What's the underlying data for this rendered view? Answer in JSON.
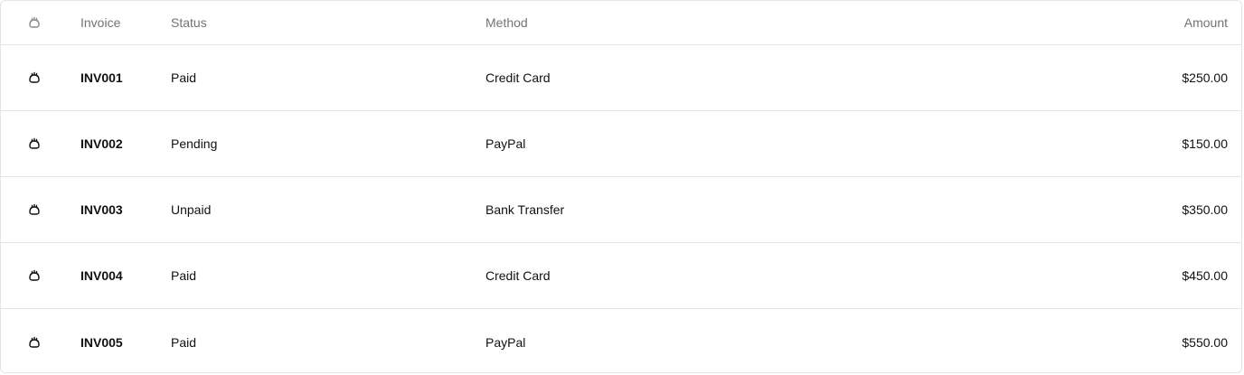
{
  "columns": {
    "handle_icon": "drag-handle-icon",
    "invoice": "Invoice",
    "status": "Status",
    "method": "Method",
    "amount": "Amount"
  },
  "rows": [
    {
      "invoice": "INV001",
      "status": "Paid",
      "method": "Credit Card",
      "amount": "$250.00"
    },
    {
      "invoice": "INV002",
      "status": "Pending",
      "method": "PayPal",
      "amount": "$150.00"
    },
    {
      "invoice": "INV003",
      "status": "Unpaid",
      "method": "Bank Transfer",
      "amount": "$350.00"
    },
    {
      "invoice": "INV004",
      "status": "Paid",
      "method": "Credit Card",
      "amount": "$450.00"
    },
    {
      "invoice": "INV005",
      "status": "Paid",
      "method": "PayPal",
      "amount": "$550.00"
    }
  ],
  "colors": {
    "border": "#e5e5e5",
    "header_text": "#737373",
    "body_text": "#111111"
  }
}
